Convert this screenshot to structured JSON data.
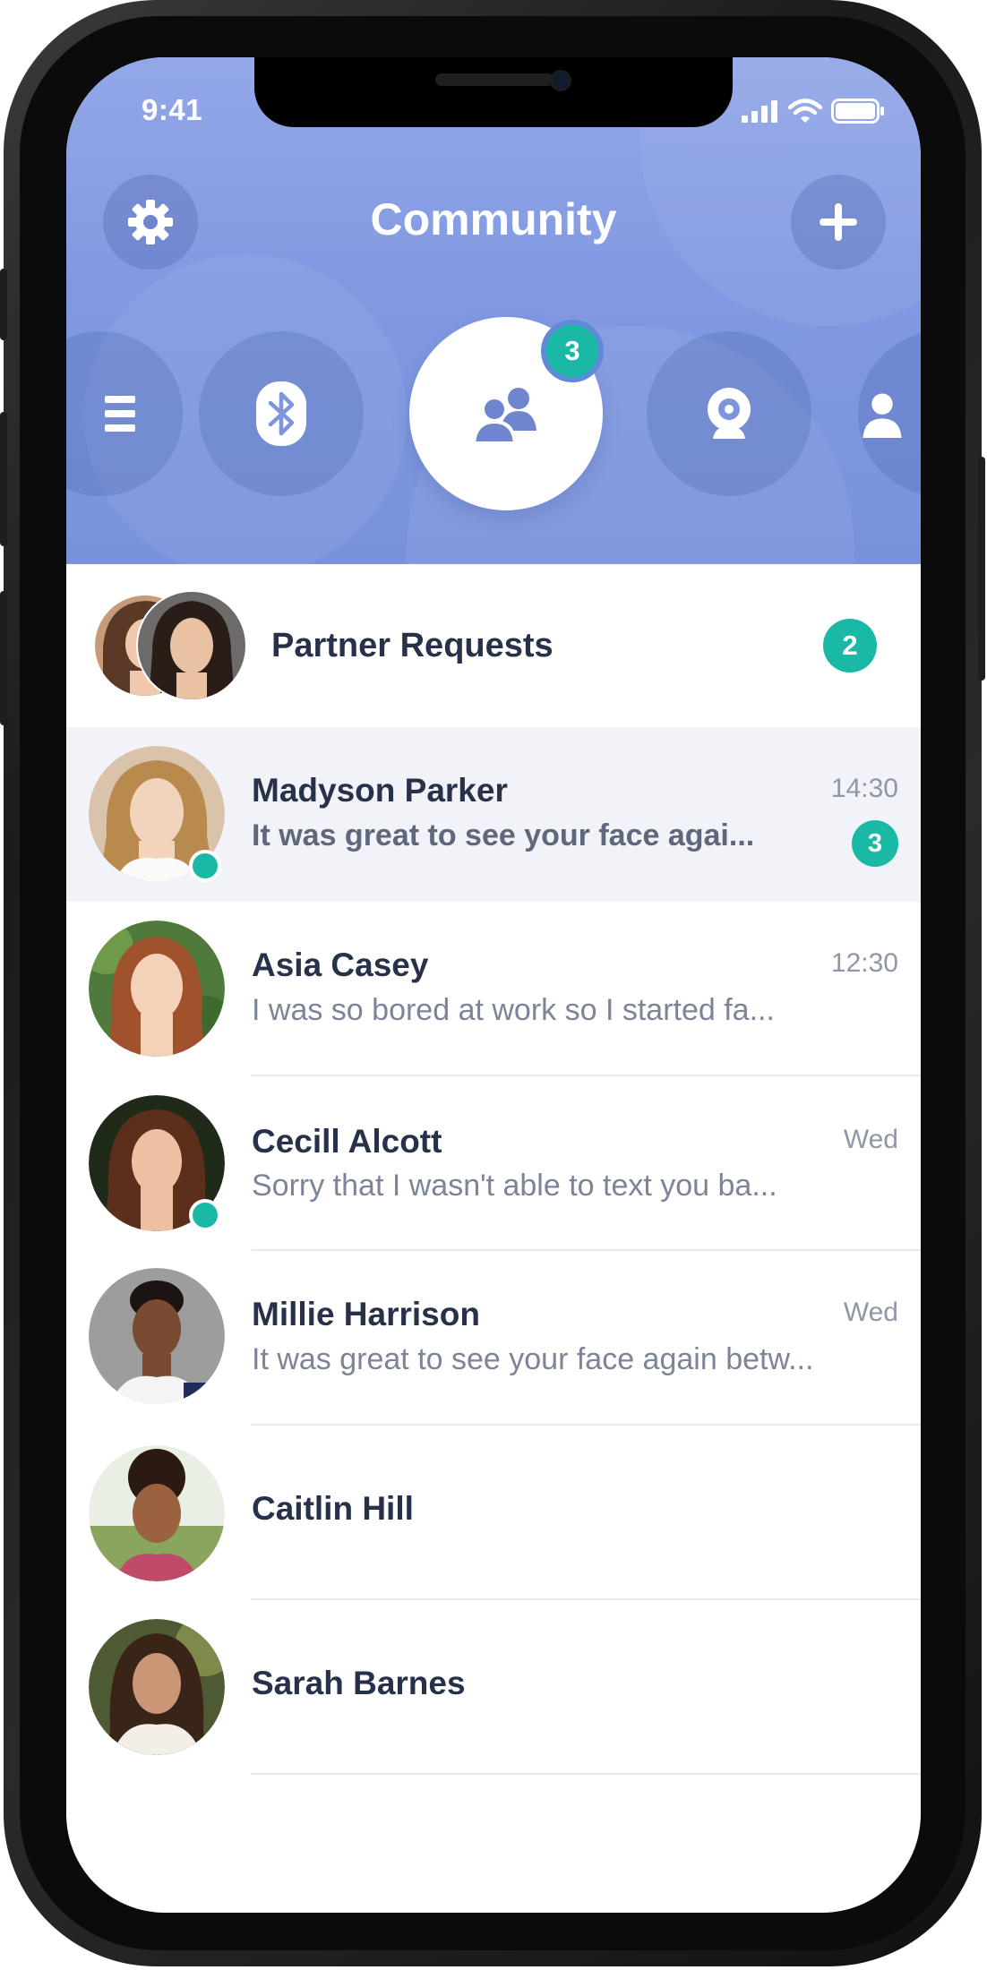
{
  "status_bar": {
    "time": "9:41"
  },
  "header": {
    "title": "Community"
  },
  "categories": [
    {
      "icon": "list-icon"
    },
    {
      "icon": "bluetooth-icon"
    },
    {
      "icon": "group-icon",
      "active": true,
      "badge": "3"
    },
    {
      "icon": "webcam-icon"
    },
    {
      "icon": "person-icon"
    }
  ],
  "partner_requests": {
    "label": "Partner Requests",
    "count": "2"
  },
  "conversations": [
    {
      "name": "Madyson Parker",
      "message": "It was great to see your face agai...",
      "time": "14:30",
      "unread": "3",
      "online": true
    },
    {
      "name": "Asia Casey",
      "message": "I was so bored at work so I started fa...",
      "time": "12:30"
    },
    {
      "name": "Cecill Alcott",
      "message": "Sorry that I wasn't able to text you ba...",
      "time": "Wed",
      "online": true
    },
    {
      "name": "Millie Harrison",
      "message": "It was great to see your face again betw...",
      "time": "Wed"
    },
    {
      "name": "Caitlin Hill"
    },
    {
      "name": "Sarah Barnes"
    }
  ],
  "colors": {
    "accent": "#1ab9a6",
    "header": "#8299e2",
    "text": "#27314a"
  }
}
